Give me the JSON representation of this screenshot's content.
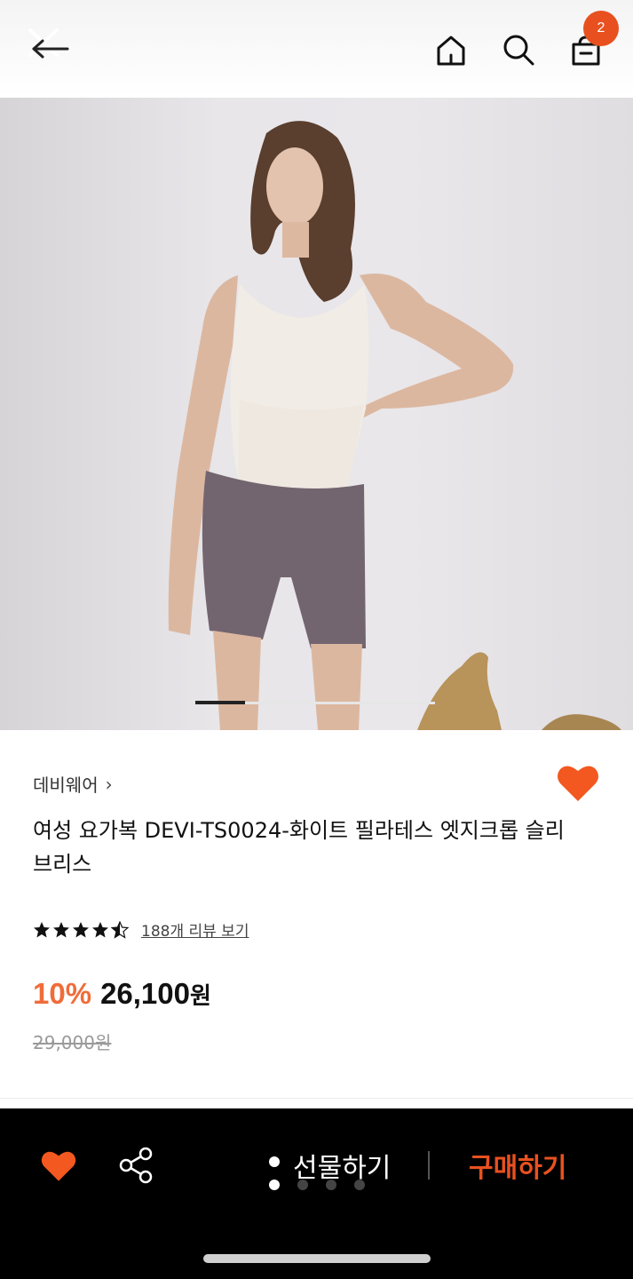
{
  "header": {
    "back_icon": "back-arrow-icon",
    "home_icon": "home-icon",
    "search_icon": "search-icon",
    "cart_icon": "shopping-bag-icon",
    "cart_count": "2"
  },
  "product": {
    "image_alt": "yoga wear product photo",
    "image_progress": 0.2,
    "brand": "데비웨어",
    "title": "여성 요가복 DEVI-TS0024-화이트 필라테스 엣지크롭 슬리브리스",
    "rating_stars": 4.5,
    "review_link": "188개 리뷰 보기",
    "discount": "10%",
    "price": "26,100",
    "currency": "원",
    "original_price": "29,000원",
    "wishlisted": true
  },
  "bottom_bar": {
    "heart_icon": "heart-icon",
    "share_icon": "share-icon",
    "gift_label": "선물하기",
    "buy_label": "구매하기"
  },
  "colors": {
    "accent": "#e8511f",
    "discount": "#f06c3a",
    "bottom_bg": "#000000"
  }
}
